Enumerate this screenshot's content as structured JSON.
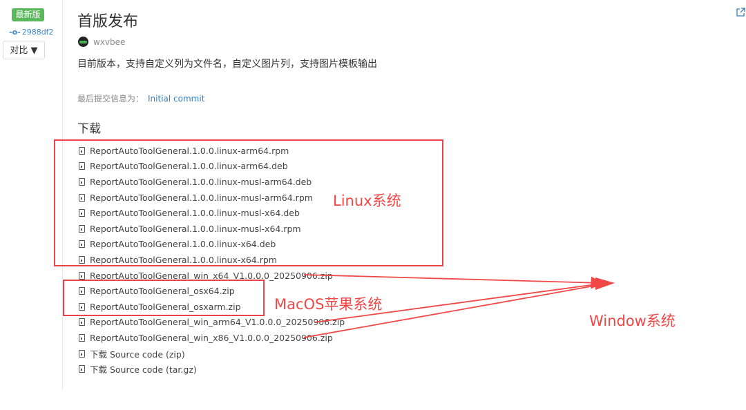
{
  "sidebar": {
    "badge": "最新版",
    "commit_hash": "2988df2",
    "compare_label": "对比 ▼"
  },
  "release": {
    "title": "首版发布",
    "author": "wxvbee",
    "description": "目前版本，支持自定义列为文件名，自定义图片列，支持图片模板输出",
    "commit_label": "最后提交信息为：",
    "commit_link": "Initial commit",
    "download_heading": "下载"
  },
  "files": [
    "ReportAutoToolGeneral.1.0.0.linux-arm64.rpm",
    "ReportAutoToolGeneral.1.0.0.linux-arm64.deb",
    "ReportAutoToolGeneral.1.0.0.linux-musl-arm64.deb",
    "ReportAutoToolGeneral.1.0.0.linux-musl-arm64.rpm",
    "ReportAutoToolGeneral.1.0.0.linux-musl-x64.deb",
    "ReportAutoToolGeneral.1.0.0.linux-musl-x64.rpm",
    "ReportAutoToolGeneral.1.0.0.linux-x64.deb",
    "ReportAutoToolGeneral.1.0.0.linux-x64.rpm",
    "ReportAutoToolGeneral_win_x64_V1.0.0.0_20250906.zip",
    "ReportAutoToolGeneral_osx64.zip",
    "ReportAutoToolGeneral_osxarm.zip",
    "ReportAutoToolGeneral_win_arm64_V1.0.0.0_20250906.zip",
    "ReportAutoToolGeneral_win_x86_V1.0.0.0_20250906.zip",
    "下载 Source code (zip)",
    "下载 Source code (tar.gz)"
  ],
  "annotations": {
    "linux": "Linux系统",
    "macos": "MacOS苹果系统",
    "windows": "Window系统",
    "color": "#f04747"
  },
  "icons": {
    "share": "external-link-icon",
    "file": "file-icon",
    "commit": "commit-icon"
  }
}
